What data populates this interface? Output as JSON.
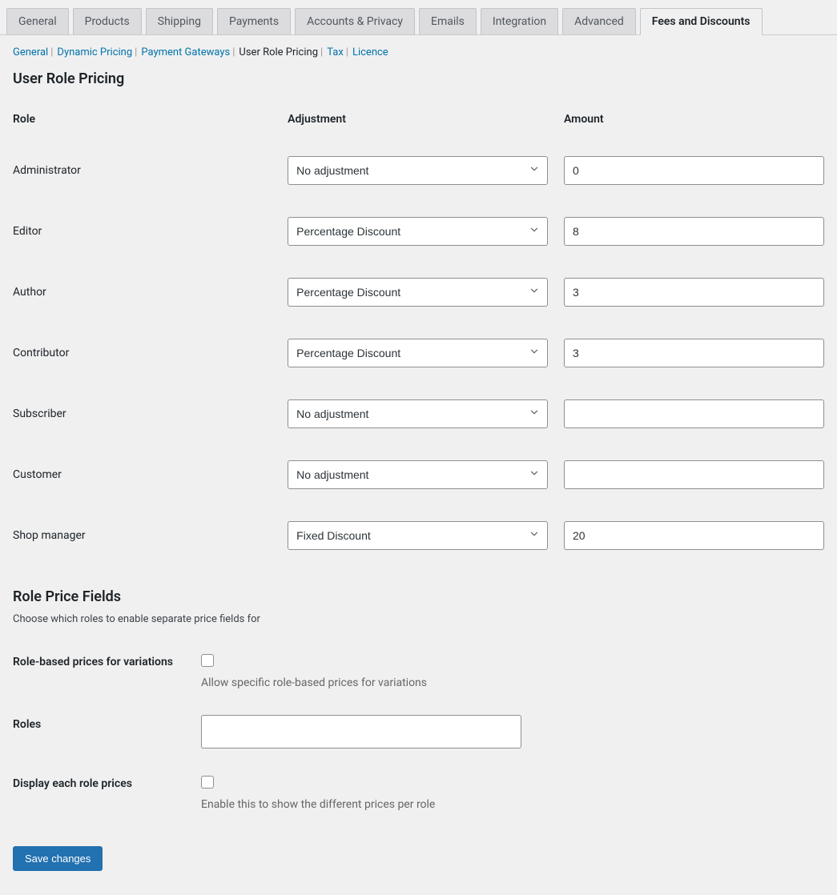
{
  "tabs": {
    "primary": [
      {
        "label": "General",
        "active": false
      },
      {
        "label": "Products",
        "active": false
      },
      {
        "label": "Shipping",
        "active": false
      },
      {
        "label": "Payments",
        "active": false
      },
      {
        "label": "Accounts & Privacy",
        "active": false
      },
      {
        "label": "Emails",
        "active": false
      },
      {
        "label": "Integration",
        "active": false
      },
      {
        "label": "Advanced",
        "active": false
      },
      {
        "label": "Fees and Discounts",
        "active": true
      }
    ]
  },
  "subnav": [
    {
      "label": "General",
      "current": false
    },
    {
      "label": "Dynamic Pricing",
      "current": false
    },
    {
      "label": "Payment Gateways",
      "current": false
    },
    {
      "label": "User Role Pricing",
      "current": true
    },
    {
      "label": "Tax",
      "current": false
    },
    {
      "label": "Licence",
      "current": false
    }
  ],
  "page_title": "User Role Pricing",
  "columns": {
    "role": "Role",
    "adjustment": "Adjustment",
    "amount": "Amount"
  },
  "adjustment_options": [
    "No adjustment",
    "Percentage Discount",
    "Fixed Discount"
  ],
  "rows": [
    {
      "role": "Administrator",
      "adjustment": "No adjustment",
      "amount": "0"
    },
    {
      "role": "Editor",
      "adjustment": "Percentage Discount",
      "amount": "8"
    },
    {
      "role": "Author",
      "adjustment": "Percentage Discount",
      "amount": "3"
    },
    {
      "role": "Contributor",
      "adjustment": "Percentage Discount",
      "amount": "3"
    },
    {
      "role": "Subscriber",
      "adjustment": "No adjustment",
      "amount": ""
    },
    {
      "role": "Customer",
      "adjustment": "No adjustment",
      "amount": ""
    },
    {
      "role": "Shop manager",
      "adjustment": "Fixed Discount",
      "amount": "20"
    }
  ],
  "role_price_fields": {
    "title": "Role Price Fields",
    "desc": "Choose which roles to enable separate price fields for",
    "variations": {
      "label": "Role-based prices for variations",
      "help": "Allow specific role-based prices for variations",
      "checked": false
    },
    "roles": {
      "label": "Roles",
      "value": ""
    },
    "display": {
      "label": "Display each role prices",
      "help": "Enable this to show the different prices per role",
      "checked": false
    }
  },
  "save_label": "Save changes"
}
